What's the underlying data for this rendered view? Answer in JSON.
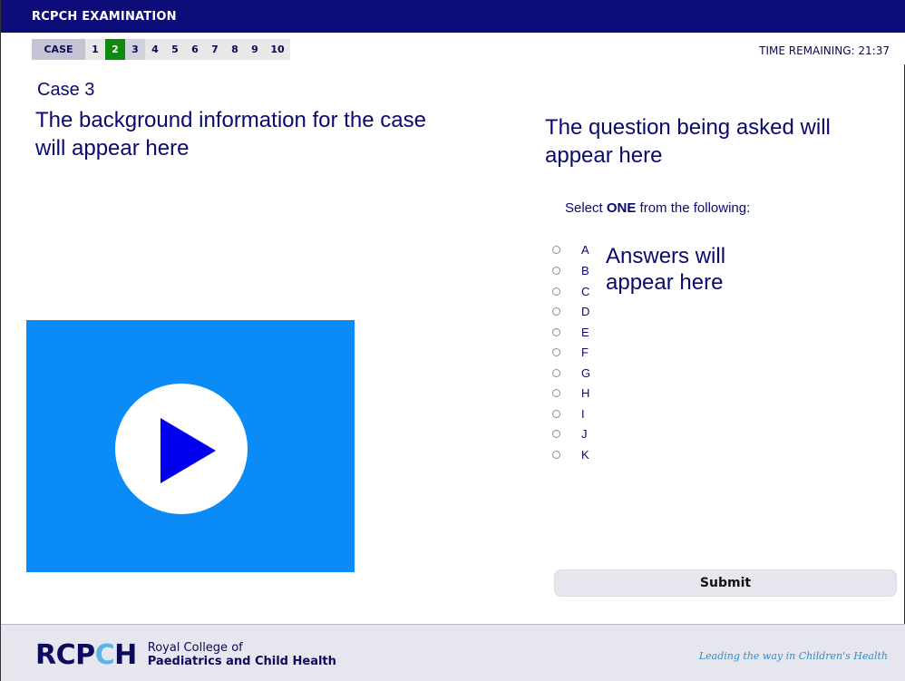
{
  "header": {
    "title": "RCPCH EXAMINATION"
  },
  "nav": {
    "case_label": "CASE",
    "cases": [
      "1",
      "2",
      "3",
      "4",
      "5",
      "6",
      "7",
      "8",
      "9",
      "10"
    ],
    "active_case": "2",
    "current_case": "3",
    "time_remaining": "TIME REMAINING: 21:37"
  },
  "case": {
    "title": "Case 3",
    "background": "The background information for the case will appear here",
    "video_icon": "play-icon"
  },
  "question": {
    "text": "The question being asked will appear here",
    "instruction_prefix": "Select ",
    "instruction_emphasis": "ONE",
    "instruction_suffix": " from the following:",
    "options": [
      "A",
      "B",
      "C",
      "D",
      "E",
      "F",
      "G",
      "H",
      "I",
      "J",
      "K"
    ],
    "answers_placeholder": "Answers will appear here",
    "submit_label": "Submit"
  },
  "footer": {
    "logo_text_a": "RCP",
    "logo_text_c": "C",
    "logo_text_h": "H",
    "logo_line1": "Royal College of",
    "logo_line2": "Paediatrics and Child Health",
    "tagline": "Leading the way in Children's Health"
  },
  "colors": {
    "header_bg": "#0d0d7a",
    "active_case": "#0e8a0e",
    "video_bg": "#0a8bf5",
    "play_triangle": "#0000ee",
    "text": "#0a0a6e"
  }
}
